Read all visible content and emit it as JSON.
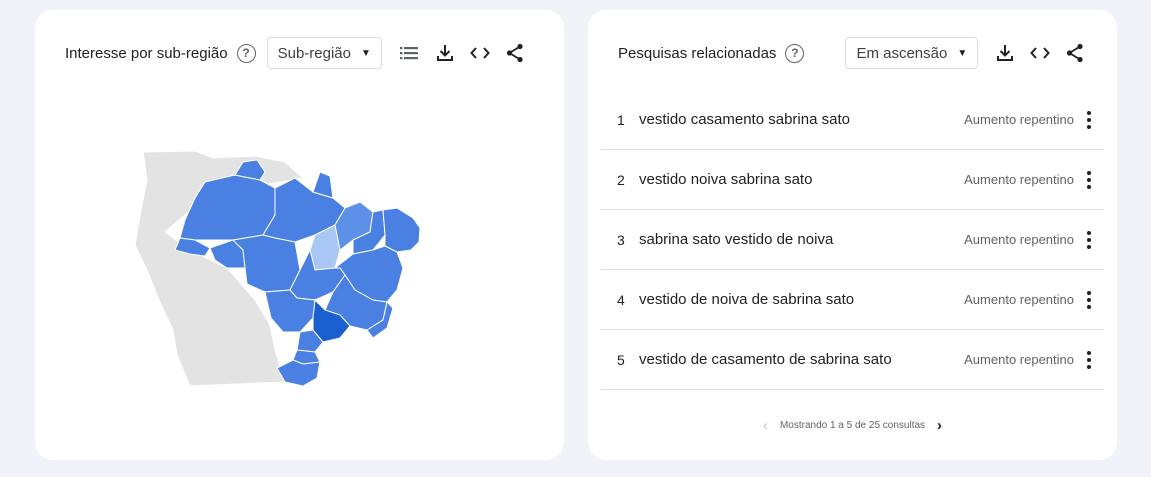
{
  "left_card": {
    "title": "Interesse por sub-região",
    "help_glyph": "?",
    "select_value": "Sub-região",
    "icons": [
      "list-icon",
      "download-icon",
      "embed-icon",
      "share-icon"
    ]
  },
  "right_card": {
    "title": "Pesquisas relacionadas",
    "help_glyph": "?",
    "select_value": "Em ascensão",
    "icons": [
      "download-icon",
      "embed-icon",
      "share-icon"
    ],
    "rows": [
      {
        "index": "1",
        "query": "vestido casamento sabrina sato",
        "value": "Aumento repentino"
      },
      {
        "index": "2",
        "query": "vestido noiva sabrina sato",
        "value": "Aumento repentino"
      },
      {
        "index": "3",
        "query": "sabrina sato vestido de noiva",
        "value": "Aumento repentino"
      },
      {
        "index": "4",
        "query": "vestido de noiva de sabrina sato",
        "value": "Aumento repentino"
      },
      {
        "index": "5",
        "query": "vestido de casamento de sabrina sato",
        "value": "Aumento repentino"
      }
    ],
    "pager_text": "Mostrando 1 a 5 de 25 consultas"
  },
  "colors": {
    "background": "#f1f3f8",
    "map_light": "#a8c7f4",
    "map_mid": "#5d91e8",
    "map_strong": "#4a80e2",
    "map_dark": "#1a5fd0",
    "neighbor_gray": "#e3e3e3"
  }
}
